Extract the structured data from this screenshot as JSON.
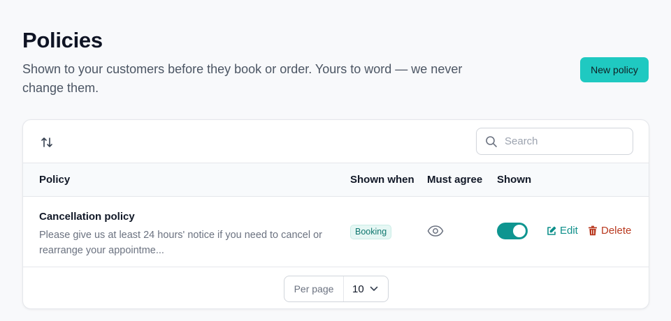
{
  "header": {
    "title": "Policies",
    "subtitle": "Shown to your customers before they book or order. Yours to word — we never change them.",
    "new_button_label": "New policy"
  },
  "toolbar": {
    "sort_icon": "sort-arrows-icon",
    "search_placeholder": "Search",
    "search_value": ""
  },
  "table": {
    "columns": [
      "Policy",
      "Shown when",
      "Must agree",
      "Shown"
    ],
    "rows": [
      {
        "name": "Cancellation policy",
        "description": "Please give us at least 24 hours' notice if you need to cancel or rearrange your appointme...",
        "shown_when": "Booking",
        "must_agree_icon": "eye-icon",
        "shown": true,
        "edit_label": "Edit",
        "delete_label": "Delete"
      }
    ]
  },
  "pagination": {
    "per_page_label": "Per page",
    "per_page_value": "10"
  },
  "colors": {
    "accent": "#1fc9c1",
    "toggle_on": "#0e9590",
    "edit": "#0e8f8a",
    "delete": "#b9391f"
  }
}
